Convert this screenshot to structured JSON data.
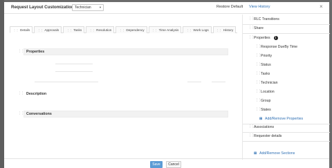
{
  "dialog": {
    "title": "Request Layout Customization",
    "template_select": "Technician",
    "restore_default": "Restore Default",
    "view_history": "View History",
    "close_glyph": "×"
  },
  "tabs": [
    "Details",
    "Approvals",
    "Tasks",
    "Resolution",
    "Dependency",
    "Time Analysis",
    "Work Logs",
    "History"
  ],
  "sections": {
    "properties": "Properties",
    "description": "Description",
    "conversations": "Conversations"
  },
  "sidebar": {
    "rlc_transitions": "RLC Transitions",
    "share": "Share",
    "properties": "Properties",
    "property_fields": [
      "Response DueBy Time",
      "Priority",
      "Status",
      "Tasks",
      "Technician",
      "Location",
      "Group",
      "States"
    ],
    "add_remove_properties": "Add/Remove Properties",
    "associations": "Associations",
    "requester_details": "Requester details",
    "add_remove_sections": "Add/Remove Sections"
  },
  "footer": {
    "save": "Save",
    "cancel": "Cancel"
  },
  "colors": {
    "accent": "#2e6fb3",
    "save_button": "#5b9bd5",
    "overlay": "#6b6b6b"
  }
}
